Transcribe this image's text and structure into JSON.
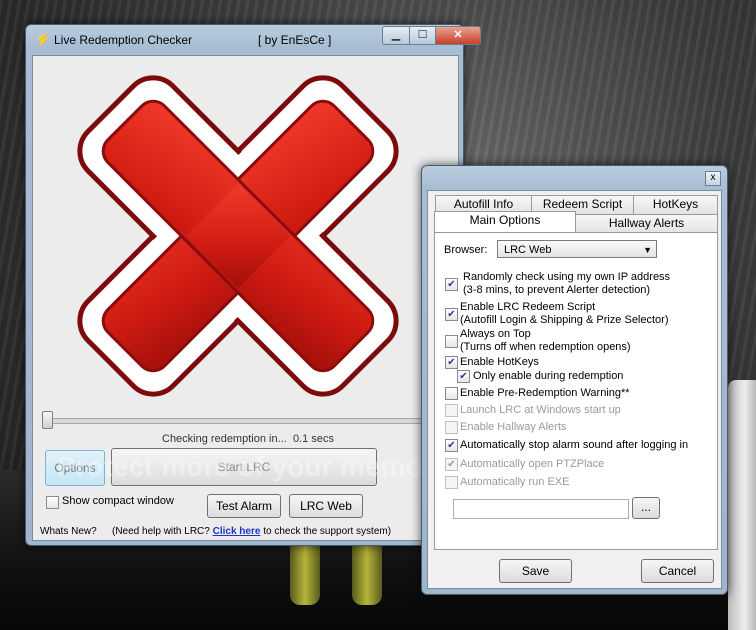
{
  "main_window": {
    "title": "Live Redemption Checker",
    "title_suffix": "[ by EnEsCe ]",
    "status_text": "Checking redemption in...",
    "status_time": "0.1 secs",
    "options_button": "Options",
    "start_button": "Start LRC",
    "compact_label": "Show compact window",
    "test_alarm_button": "Test Alarm",
    "lrc_web_button": "LRC Web",
    "whats_new": "Whats New?",
    "help_prefix": "(Need help with LRC?",
    "help_link": "Click here",
    "help_suffix": "to check the support system)"
  },
  "options_window": {
    "tabs": [
      "Autofill Info",
      "Redeem Script",
      "HotKeys",
      "Main Options",
      "Hallway Alerts"
    ],
    "selected_tab": "Main Options",
    "browser_label": "Browser:",
    "browser_value": "LRC Web",
    "options": [
      {
        "line1": "Randomly check using my own IP address",
        "line2": "(3-8 mins, to prevent Alerter detection)",
        "checked": true,
        "enabled": true
      },
      {
        "line1": "Enable LRC Redeem Script",
        "line2": "(Autofill Login & Shipping & Prize Selector)",
        "checked": true,
        "enabled": true
      },
      {
        "line1": "Always on Top",
        "line2": "(Turns off when redemption opens)",
        "checked": false,
        "enabled": true
      },
      {
        "line1": "Enable HotKeys",
        "checked": true,
        "enabled": true
      },
      {
        "line1": "Only enable during redemption",
        "checked": true,
        "enabled": true
      },
      {
        "line1": "Enable Pre-Redemption Warning**",
        "checked": false,
        "enabled": true
      },
      {
        "line1": "Launch LRC at Windows start up",
        "checked": false,
        "enabled": false
      },
      {
        "line1": "Enable Hallway Alerts",
        "checked": false,
        "enabled": false
      },
      {
        "line1": "Automatically stop alarm sound after logging in",
        "checked": true,
        "enabled": true
      },
      {
        "line1": "Automatically open PTZPlace",
        "checked": true,
        "enabled": false
      },
      {
        "line1": "Automatically run EXE",
        "checked": false,
        "enabled": false
      }
    ],
    "exe_path": "",
    "browse_button": "...",
    "save_button": "Save",
    "cancel_button": "Cancel"
  },
  "watermark": "Protect more of your memories",
  "colors": {
    "x_red": "#d9231a",
    "x_outline": "#8a0d0d",
    "link": "#1a33c5"
  }
}
